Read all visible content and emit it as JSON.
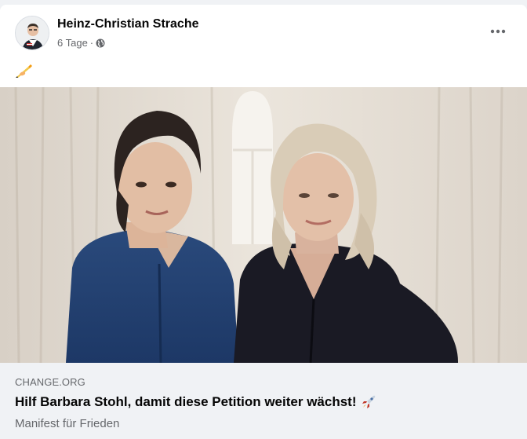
{
  "post": {
    "author": "Heinz-Christian Strache",
    "time": "6 Tage",
    "separator": "·",
    "privacy_icon": "globe-icon",
    "more_icon": "more-options-icon",
    "body_emoji": "writing-hand-icon"
  },
  "link_preview": {
    "domain": "CHANGE.ORG",
    "title": "Hilf Barbara Stohl, damit diese Petition weiter wächst!",
    "title_emoji": "rocket-icon",
    "description": "Manifest für Frieden"
  },
  "colors": {
    "card_bg": "#ffffff",
    "page_bg": "#f0f2f5",
    "footer_bg": "#f0f2f5",
    "primary_text": "#050505",
    "secondary_text": "#65676b"
  }
}
